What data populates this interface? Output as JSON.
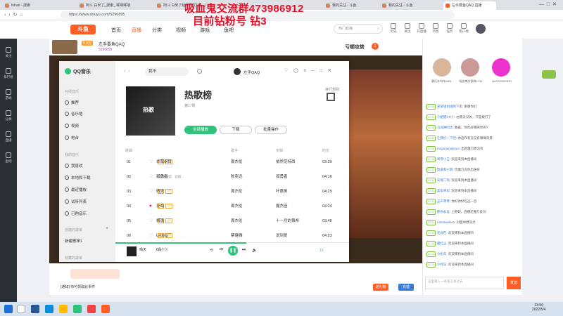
{
  "browser": {
    "tabs": [
      {
        "label": "fohan - 搜索"
      },
      {
        "label": "阿斗 白米了_搜索_ 眸嗯眸嗯"
      },
      {
        "label": "阿斗 白米了给个人文化 [...]"
      },
      {
        "label": "我的关注 - 斗鱼"
      },
      {
        "label": "我的关注 - 斗鱼"
      },
      {
        "label": "左手要鱼QAQ 直播"
      }
    ],
    "url": "https://www.douyu.com/5296895"
  },
  "overlay": {
    "line1": "吸血鬼交流群473986912",
    "line2": "目前钻粉号 钻3"
  },
  "site": {
    "logo": "斗鱼",
    "nav": [
      "首页",
      "直播",
      "分类",
      "视频",
      "游戏",
      "鱼吧"
    ],
    "search_placeholder": "热门直播",
    "header_icons": [
      {
        "icon": "history-icon",
        "label": "历史"
      },
      {
        "icon": "follow-icon",
        "label": "关注"
      },
      {
        "icon": "open-live-icon",
        "label": "开直播"
      },
      {
        "icon": "message-icon",
        "label": "消息"
      },
      {
        "icon": "task-icon",
        "label": "任务"
      },
      {
        "icon": "download-icon",
        "label": "客户端"
      }
    ]
  },
  "room": {
    "badge": "5.3万",
    "title": "左手要鱼QAQ",
    "id": "5296895",
    "hot_label": "亏顿攻势",
    "hot_value": "1"
  },
  "left_sidebar": [
    "关注",
    "排行榜",
    "游戏",
    "分类",
    "直播",
    "鱼吧"
  ],
  "qq": {
    "brand": "QQ音乐",
    "search_value": "我不",
    "user": "左手QAQ",
    "sections": {
      "online": "在线音乐",
      "mine": "我的音乐",
      "created": "创建的歌单",
      "collected": "收藏的歌单"
    },
    "online_items": [
      "推荐",
      "音乐馆",
      "视频",
      "电台"
    ],
    "mine_items": [
      "我喜欢",
      "本地和下载",
      "最近播放",
      "试听列表",
      "已购音乐"
    ],
    "playlist_created": "新建歌单1",
    "playlist": {
      "title": "热歌榜",
      "subtitle": "第17周",
      "cover_text": "热歌",
      "play_all": "全部播放",
      "download": "下载",
      "batch": "批量操作",
      "rank_label": "排行规则"
    },
    "headers": {
      "song": "歌曲",
      "singer": "歌手",
      "album": "专辑",
      "duration": "时长"
    },
    "songs": [
      {
        "no": "01",
        "title": "本草纲目",
        "singer": "周杰伦",
        "album": "依然范特西",
        "duration": "03:29",
        "liked": false
      },
      {
        "no": "02",
        "title": "孤勇者",
        "extra": "(《英雄联盟：双城...",
        "singer": "陈奕迅",
        "album": "孤勇者",
        "duration": "04:16",
        "liked": false
      },
      {
        "no": "03",
        "title": "晴天",
        "singer": "周杰伦",
        "album": "叶惠美",
        "duration": "04:29",
        "liked": false
      },
      {
        "no": "04",
        "title": "花海",
        "singer": "周杰伦",
        "album": "魔杰座",
        "duration": "04:24",
        "liked": true
      },
      {
        "no": "05",
        "title": "搁浅",
        "singer": "周杰伦",
        "album": "十一月的萧邦",
        "duration": "03:46",
        "liked": false
      },
      {
        "no": "06",
        "title": "Letting Go",
        "singer": "蔡健雅",
        "album": "说到爱",
        "duration": "04:23",
        "liked": false
      }
    ],
    "player": {
      "now_title": "晴天",
      "now_artist": "周杰伦",
      "progress": 0.56,
      "volume_label": "10"
    }
  },
  "chat": {
    "anchors": [
      {
        "name": "摩托车叫车AAB",
        "lv": "Lv6"
      },
      {
        "name": "吸血鬼交流群4739",
        "lv": "Lv6"
      },
      {
        "name": "NeVDDDDDDD",
        "lv": "Lv6"
      }
    ],
    "messages": [
      {
        "lv": "LV 30",
        "user": "某某组组组顾下客",
        "text": "谢谢你们"
      },
      {
        "lv": "LV 21",
        "user": "小肥肥5大小",
        "text": "左眼没没关，只是被打了"
      },
      {
        "lv": "LV 15",
        "user": "乌龙钟阿达",
        "text": "我操，你咋好哦突然的?"
      },
      {
        "lv": "LV 20",
        "user": "让我们一下吧",
        "text": "你这咋有没没有嗅嗅背景"
      },
      {
        "lv": "LV 10",
        "user": "mogaoanaikeyo",
        "text": "出新魔刀更没有"
      },
      {
        "lv": "LV 19",
        "user": "新帝小王",
        "text": "欢迎来到本直播间"
      },
      {
        "lv": "LV 20",
        "user": "狗逼和小明",
        "text": "饮魔刀没你出谁杀"
      },
      {
        "lv": "LV 34",
        "user": "吴瑞二狗",
        "text": "欢迎来到本直播间"
      },
      {
        "lv": "LV 31",
        "user": "美军将军",
        "text": "欢迎来到本直播间"
      },
      {
        "lv": "LV 20",
        "user": "五千零零",
        "text": "你好你好吃这一首"
      },
      {
        "lv": "LV 11",
        "user": "愿你永远",
        "text": "上野如，直播还魔刀反剑"
      },
      {
        "lv": "LV 13",
        "user": "Aiinetwalkoo",
        "text": "对面中野双点"
      },
      {
        "lv": "LV 21",
        "user": "老虎在",
        "text": "欢迎来到本直播间"
      },
      {
        "lv": "LV 10",
        "user": "最红尘",
        "text": "欢迎来到本直播间"
      },
      {
        "lv": "LV 14",
        "user": "小松岛",
        "text": "欢迎来到本直播间"
      },
      {
        "lv": "LV 10",
        "user": "小绿马",
        "text": "欢迎来到本直播间"
      }
    ],
    "input_placeholder": "这里输入一条留言发过去",
    "send": "发送"
  },
  "bottom": {
    "notice": "[通知] 你可领取此事件",
    "stats": [
      "17",
      "28",
      "12",
      "14"
    ],
    "buttons": [
      "送礼物",
      "充值"
    ]
  },
  "clock": {
    "time": "23:50",
    "date": "2022/5/4"
  },
  "colors": {
    "accent_red": "#e8102a",
    "qq_green": "#31c27c",
    "douyu_orange": "#ff5d23"
  }
}
